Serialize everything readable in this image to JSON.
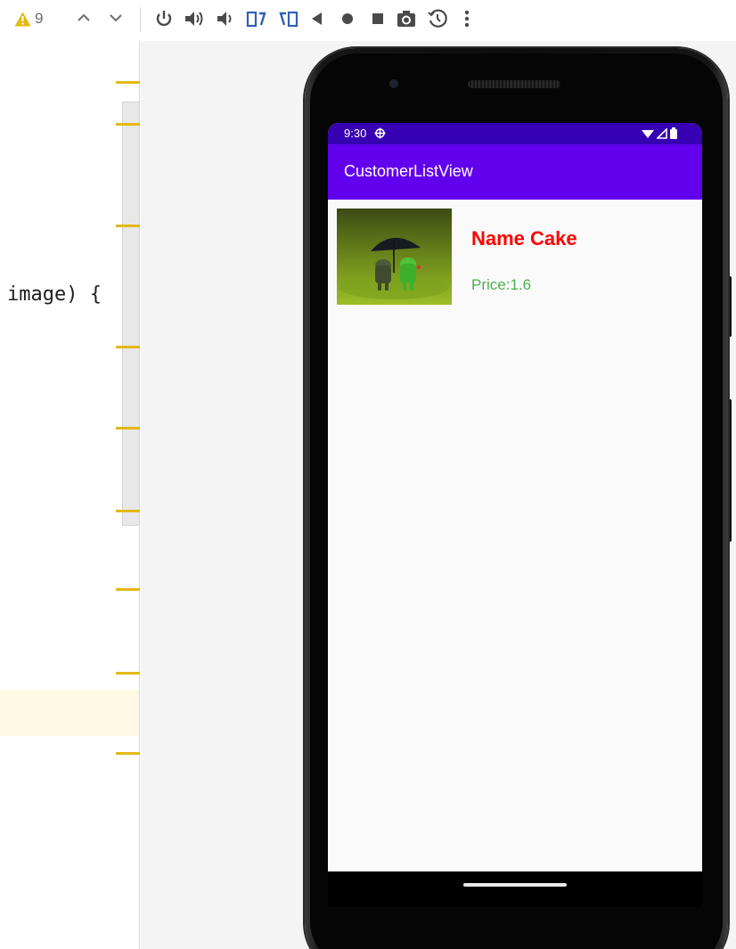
{
  "toolbar": {
    "warning_count": "9",
    "buttons": [
      {
        "name": "power-icon"
      },
      {
        "name": "volume-up-icon"
      },
      {
        "name": "volume-down-icon"
      },
      {
        "name": "rotate-left-icon"
      },
      {
        "name": "rotate-right-icon"
      },
      {
        "name": "back-icon"
      },
      {
        "name": "home-icon"
      },
      {
        "name": "overview-icon"
      },
      {
        "name": "camera-icon"
      },
      {
        "name": "snapshot-icon"
      },
      {
        "name": "more-icon"
      }
    ]
  },
  "editor": {
    "code_fragment": "image) {"
  },
  "device": {
    "status_time": "9:30",
    "app_title": "CustomerListView",
    "items": [
      {
        "name": "Name Cake",
        "price": "Price:1.6"
      }
    ]
  },
  "colors": {
    "accent": "#6200ee",
    "status_bar": "#3700b3",
    "name_text": "#ff0000",
    "price_text": "#4caf50",
    "warning": "#e3b913"
  }
}
